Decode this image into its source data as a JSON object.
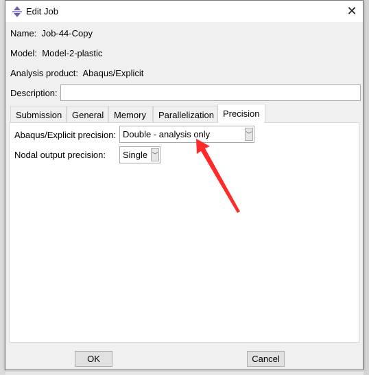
{
  "window": {
    "title": "Edit Job",
    "close_icon": "close-icon"
  },
  "fields": {
    "name_label": "Name:",
    "name_value": "Job-44-Copy",
    "model_label": "Model:",
    "model_value": "Model-2-plastic",
    "product_label": "Analysis product:",
    "product_value": "Abaqus/Explicit",
    "description_label": "Description:",
    "description_value": ""
  },
  "tabs": [
    {
      "label": "Submission"
    },
    {
      "label": "General"
    },
    {
      "label": "Memory"
    },
    {
      "label": "Parallelization"
    },
    {
      "label": "Precision",
      "selected": true
    }
  ],
  "precision": {
    "explicit_label": "Abaqus/Explicit precision:",
    "explicit_value": "Double - analysis only",
    "nodal_label": "Nodal output precision:",
    "nodal_value": "Single"
  },
  "buttons": {
    "ok": "OK",
    "cancel": "Cancel"
  },
  "annotation": {
    "arrow_color": "#ff2a2a"
  }
}
